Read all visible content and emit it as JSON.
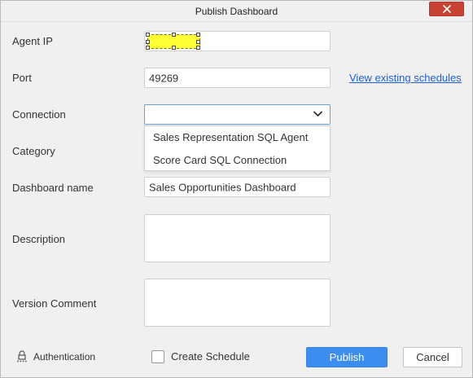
{
  "dialog": {
    "title": "Publish Dashboard",
    "close_icon": "close-icon"
  },
  "form": {
    "agent_ip": {
      "label": "Agent IP",
      "value": ""
    },
    "port": {
      "label": "Port",
      "value": "49269"
    },
    "view_schedules_link": "View existing schedules",
    "connection": {
      "label": "Connection",
      "value": "",
      "icon": "chevron-down-icon",
      "options": [
        "Sales Representation SQL Agent",
        "Score Card SQL Connection"
      ]
    },
    "category": {
      "label": "Category"
    },
    "dashboard_name": {
      "label": "Dashboard name",
      "value": "Sales Opportunities Dashboard"
    },
    "description": {
      "label": "Description",
      "value": ""
    },
    "version_comment": {
      "label": "Version Comment",
      "value": ""
    }
  },
  "footer": {
    "authentication": {
      "label": "Authentication",
      "icon": "lock-icon"
    },
    "create_schedule": {
      "label": "Create Schedule",
      "checked": false
    },
    "publish_button": "Publish",
    "cancel_button": "Cancel"
  },
  "colors": {
    "accent": "#3b8ef0",
    "link": "#1f5fdb",
    "close": "#c74233",
    "selection_highlight": "#ffff33"
  }
}
